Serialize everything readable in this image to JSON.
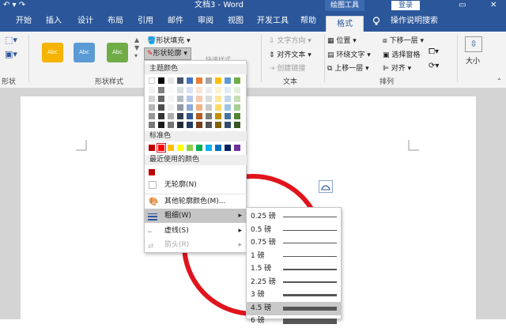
{
  "titlebar": {
    "qa_icons": "↶ ▾ ↷",
    "title": "文档3 - Word",
    "context": "绘图工具",
    "login": "登录",
    "restore": "▭",
    "close": "✕"
  },
  "tabs": [
    "开始",
    "插入",
    "设计",
    "布局",
    "引用",
    "邮件",
    "审阅",
    "视图",
    "开发工具",
    "帮助",
    "格式",
    "操作说明搜索"
  ],
  "active_tab": "格式",
  "ribbon": {
    "style_text": "Abc",
    "style_colors": [
      "#f5b400",
      "#5b9bd5",
      "#70ad47"
    ],
    "fill": "形状填充",
    "outline": "形状轮廓",
    "dim_fast": "快速样式",
    "text_dir": "文字方向",
    "align_text": "对齐文本",
    "create_link": "创建链接",
    "position": "位置",
    "wrap": "环绕文字",
    "bring_fwd": "上移一层",
    "send_back": "下移一层",
    "sel_pane": "选择窗格",
    "align": "对齐",
    "size": "大小",
    "groups": {
      "shape": "形状",
      "style": "形状样式",
      "text": "文本",
      "arrange": "排列"
    }
  },
  "menu": {
    "theme_header": "主题颜色",
    "standard_header": "标准色",
    "recent_header": "最近使用的颜色",
    "theme_top": [
      "#ffffff",
      "#000000",
      "#e7e6e6",
      "#44546a",
      "#4472c4",
      "#ed7d31",
      "#a5a5a5",
      "#ffc000",
      "#5b9bd5",
      "#70ad47"
    ],
    "standard": [
      "#c00000",
      "#ff0000",
      "#ffc000",
      "#ffff00",
      "#92d050",
      "#00b050",
      "#00b0f0",
      "#0070c0",
      "#002060",
      "#7030a0"
    ],
    "recent": [
      "#c00000"
    ],
    "no_outline": "无轮廓(N)",
    "more_colors": "其他轮廓颜色(M)...",
    "weight": "粗细(W)",
    "dashes": "虚线(S)",
    "arrows": "箭头(R)"
  },
  "weights": [
    {
      "label": "0.25 磅",
      "pt": 0.25
    },
    {
      "label": "0.5 磅",
      "pt": 0.5
    },
    {
      "label": "0.75 磅",
      "pt": 0.75
    },
    {
      "label": "1 磅",
      "pt": 1
    },
    {
      "label": "1.5 磅",
      "pt": 1.5
    },
    {
      "label": "2.25 磅",
      "pt": 2.25
    },
    {
      "label": "3 磅",
      "pt": 3
    },
    {
      "label": "4.5 磅",
      "pt": 4.5
    },
    {
      "label": "6 磅",
      "pt": 6
    }
  ],
  "selected_weight": "4.5 磅",
  "shape_color": "#e0141c"
}
